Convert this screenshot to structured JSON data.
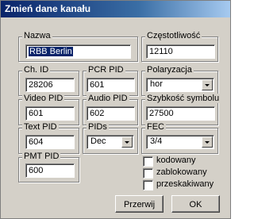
{
  "window": {
    "title": "Zmień dane kanału"
  },
  "fields": {
    "nazwa": {
      "label": "Nazwa",
      "value": "RBB Berlin"
    },
    "czestotliwosc": {
      "label": "Częstotliwość",
      "value": "12110"
    },
    "ch_id": {
      "label": "Ch. ID",
      "value": "28206"
    },
    "pcr_pid": {
      "label": "PCR PID",
      "value": "601"
    },
    "polaryzacja": {
      "label": "Polaryzacja",
      "value": "hor"
    },
    "video_pid": {
      "label": "Video PID",
      "value": "601"
    },
    "audio_pid": {
      "label": "Audio PID",
      "value": "602"
    },
    "szybkosc_symbolu": {
      "label": "Szybkość symbolu",
      "value": "27500"
    },
    "text_pid": {
      "label": "Text PID",
      "value": "604"
    },
    "pids": {
      "label": "PIDs",
      "value": "Dec"
    },
    "fec": {
      "label": "FEC",
      "value": "3/4"
    },
    "pmt_pid": {
      "label": "PMT PID",
      "value": "600"
    }
  },
  "checkboxes": [
    {
      "label": "kodowany",
      "checked": false
    },
    {
      "label": "zablokowany",
      "checked": false
    },
    {
      "label": "przeskakiwany",
      "checked": false
    }
  ],
  "buttons": {
    "cancel": "Przerwij",
    "ok": "OK"
  }
}
